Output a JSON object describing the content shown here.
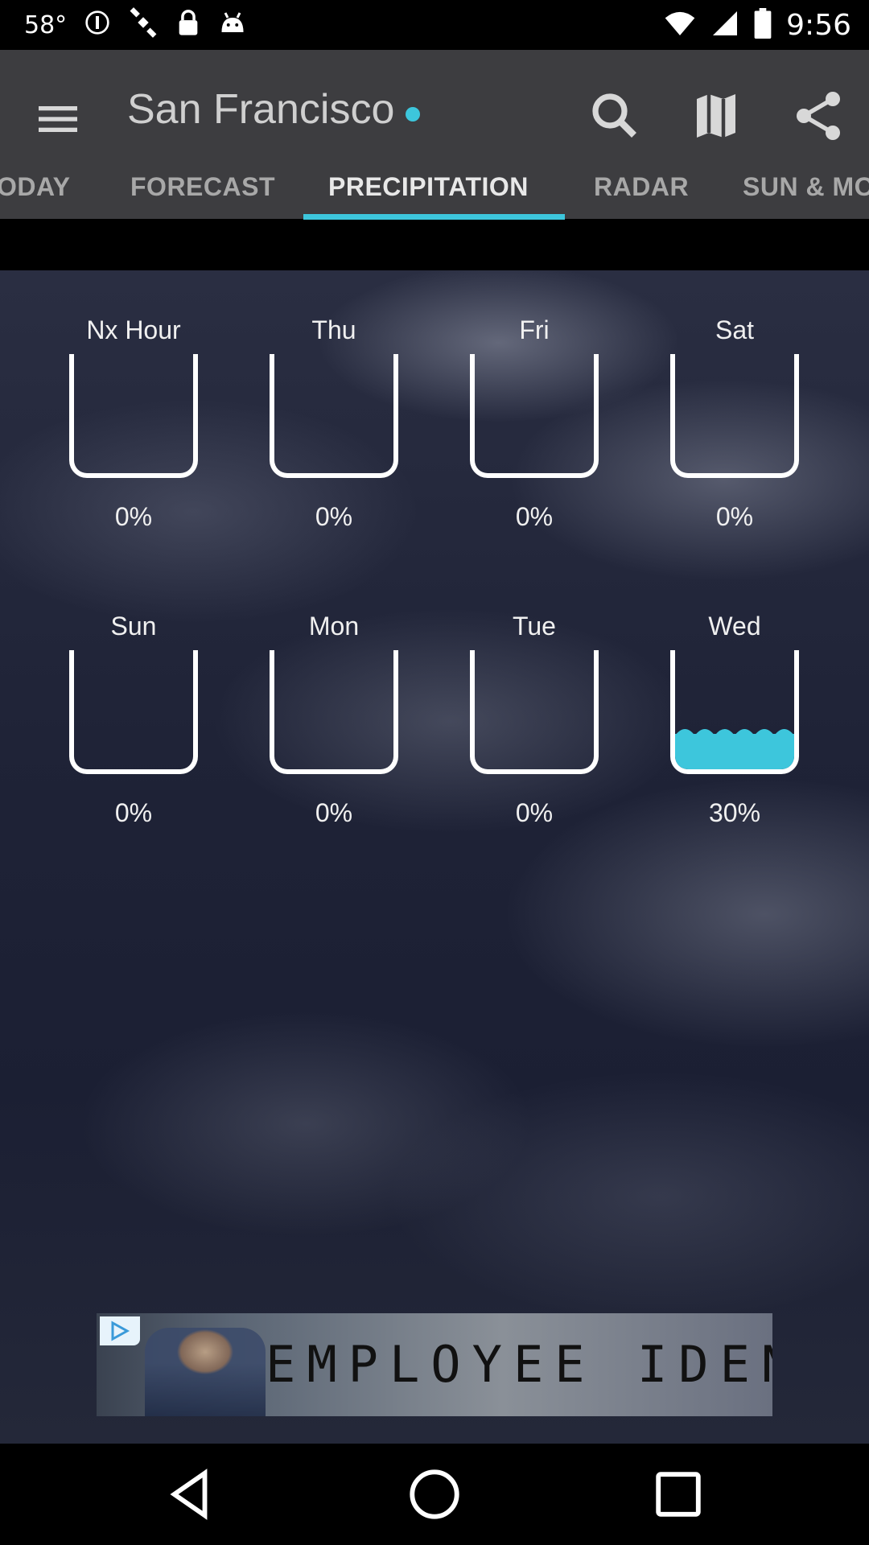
{
  "status_bar": {
    "temperature": "58°",
    "icons": [
      "info-icon",
      "satellite-icon",
      "lock-icon",
      "android-icon"
    ],
    "time": "9:56"
  },
  "header": {
    "city": "San Francisco",
    "icons": [
      "menu-icon",
      "search-icon",
      "map-icon",
      "share-icon"
    ]
  },
  "tabs": [
    {
      "label": "ODAY"
    },
    {
      "label": "FORECAST"
    },
    {
      "label": "PRECIPITATION",
      "active": true
    },
    {
      "label": "RADAR"
    },
    {
      "label": "SUN & MO"
    }
  ],
  "precipitation": [
    {
      "day": "Nx Hour",
      "percent_label": "0%",
      "fill": 0
    },
    {
      "day": "Thu",
      "percent_label": "0%",
      "fill": 0
    },
    {
      "day": "Fri",
      "percent_label": "0%",
      "fill": 0
    },
    {
      "day": "Sat",
      "percent_label": "0%",
      "fill": 0
    },
    {
      "day": "Sun",
      "percent_label": "0%",
      "fill": 0
    },
    {
      "day": "Mon",
      "percent_label": "0%",
      "fill": 0
    },
    {
      "day": "Tue",
      "percent_label": "0%",
      "fill": 0
    },
    {
      "day": "Wed",
      "percent_label": "30%",
      "fill": 0.3
    }
  ],
  "ad": {
    "text": "EMPLOYEE IDENTITIES"
  },
  "colors": {
    "accent": "#3dc6dc",
    "appbar": "#3d3d40"
  }
}
